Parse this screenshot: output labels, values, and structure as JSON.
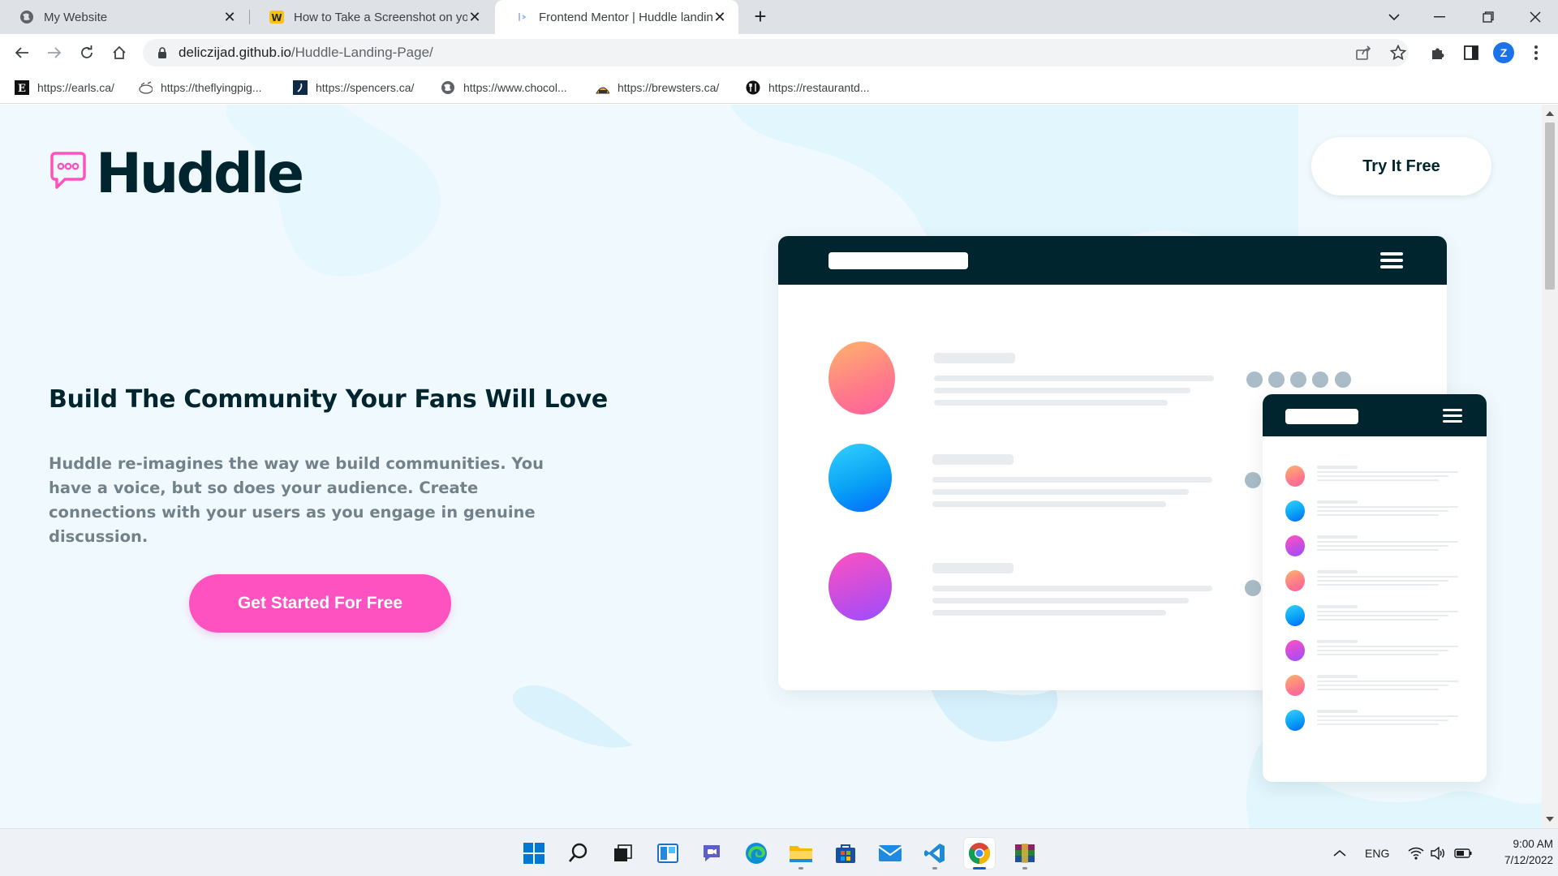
{
  "browser": {
    "tabs": [
      {
        "title": "My Website",
        "icon": "globe-icon",
        "active": false
      },
      {
        "title": "How to Take a Screenshot on your",
        "icon": "wikihow-icon",
        "active": false
      },
      {
        "title": "Frontend Mentor | Huddle landing",
        "icon": "frontend-mentor-icon",
        "active": true
      }
    ],
    "url_host": "deliczijad.github.io",
    "url_path": "/Huddle-Landing-Page/",
    "profile_initial": "Z",
    "bookmarks": [
      {
        "label": "https://earls.ca/",
        "icon": "earls-icon"
      },
      {
        "label": "https://theflyingpig...",
        "icon": "flying-pig-icon"
      },
      {
        "label": "https://spencers.ca/",
        "icon": "spencers-icon"
      },
      {
        "label": "https://www.chocol...",
        "icon": "globe-icon"
      },
      {
        "label": "https://brewsters.ca/",
        "icon": "brewsters-icon"
      },
      {
        "label": "https://restaurantd...",
        "icon": "restaurant-icon"
      }
    ]
  },
  "page": {
    "logo_text": "Huddle",
    "try_button": "Try It Free",
    "headline": "Build The Community Your Fans Will Love",
    "description": "Huddle re-imagines the way we build communities. You have a voice, but so does your audience. Create connections with your users as you engage in genuine discussion.",
    "cta_button": "Get Started For Free",
    "colors": {
      "brand_dark": "#00252e",
      "cta_pink": "#ff52c1",
      "background": "#f0fafe"
    }
  },
  "taskbar": {
    "apps": [
      "start-icon",
      "search-icon",
      "task-view-icon",
      "widgets-icon",
      "teams-chat-icon",
      "edge-icon",
      "file-explorer-icon",
      "store-icon",
      "mail-icon",
      "vscode-icon",
      "chrome-icon",
      "winrar-icon"
    ],
    "language": "ENG",
    "time": "9:00 AM",
    "date": "7/12/2022"
  }
}
